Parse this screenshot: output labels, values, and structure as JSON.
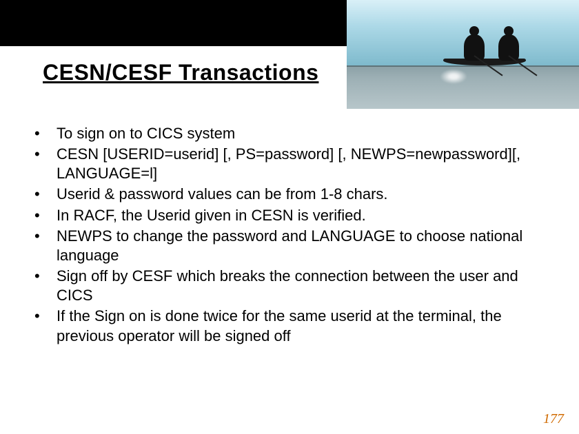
{
  "header": {
    "title": "CESN/CESF Transactions"
  },
  "bullets": [
    "To sign on to CICS system",
    "CESN      [USERID=userid] [, PS=password] [, NEWPS=newpassword][, LANGUAGE=l]",
    " Userid & password values can be from 1-8 chars.",
    "In RACF, the Userid given  in CESN is verified.",
    "NEWPS to change the  password and LANGUAGE to choose national language",
    "Sign off by CESF which breaks the connection between the user and CICS",
    "If  the Sign on is done twice for the same userid at the terminal, the previous operator will be signed off"
  ],
  "page_number": "177"
}
